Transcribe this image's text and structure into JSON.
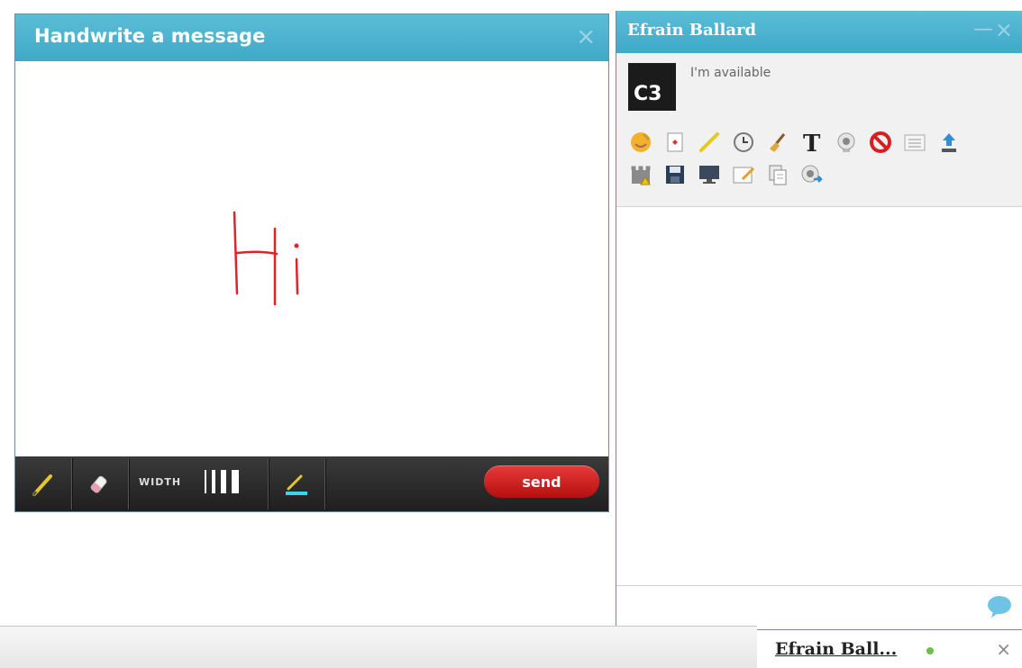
{
  "handwrite": {
    "title": "Handwrite a message",
    "close_glyph": "×",
    "canvas_text": "Hi",
    "ink_color": "#e0222a",
    "toolbar": {
      "pencil_icon": "pencil-icon",
      "eraser_icon": "eraser-icon",
      "width_label": "WIDTH",
      "color_icon": "color-picker-icon",
      "send_label": "send"
    }
  },
  "chat": {
    "contact_name": "Efrain Ballard",
    "minimize_glyph": "—",
    "close_glyph": "×",
    "avatar_text": "C3",
    "status": "I'm available",
    "icons_row1": [
      "emoticon-icon",
      "card-icon",
      "pencil-icon",
      "clock-icon",
      "broom-icon",
      "text-icon",
      "webcam-icon",
      "block-icon",
      "list-icon",
      "upload-icon"
    ],
    "icons_row2": [
      "castle-icon",
      "save-icon",
      "monitor-icon",
      "note-icon",
      "copy-icon",
      "share-icon"
    ]
  },
  "bottom": {
    "tab_name": "Efrain Ball...",
    "tab_close": "×",
    "status_color": "#6cbf4a"
  },
  "colors": {
    "header_blue": "#47b1cd",
    "send_red": "#d02020",
    "toolbar_dark": "#2b2b2b"
  }
}
